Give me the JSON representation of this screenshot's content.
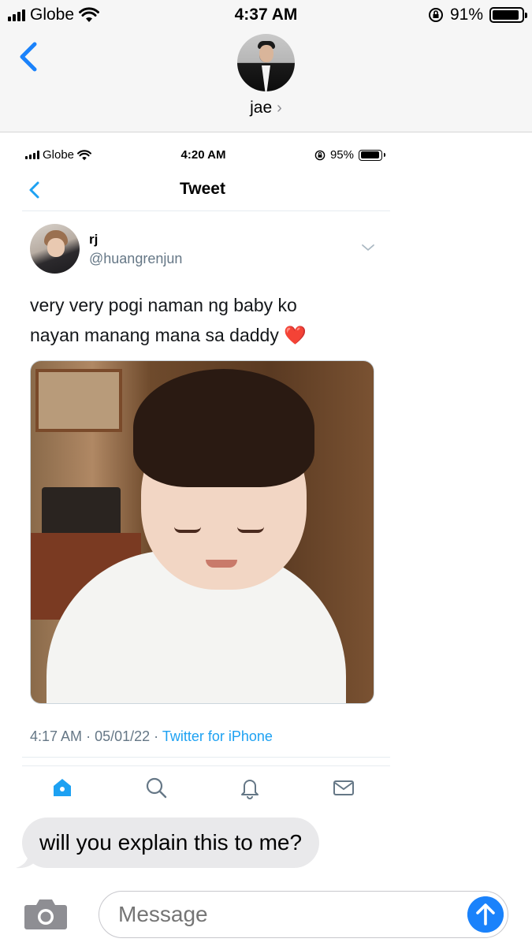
{
  "status_bar": {
    "carrier": "Globe",
    "time": "4:37 AM",
    "battery_pct": "91%",
    "battery_level": 0.91
  },
  "conversation": {
    "contact_name": "jae",
    "contact_chevron": "›"
  },
  "screenshot": {
    "status_bar": {
      "carrier": "Globe",
      "time": "4:20 AM",
      "battery_pct": "95%",
      "battery_level": 0.95
    },
    "nav_title": "Tweet",
    "tweet": {
      "author_name": "rj",
      "author_handle": "@huangrenjun",
      "text_line1": "very very pogi naman ng baby ko",
      "text_line2": "nayan manang mana sa daddy ❤️",
      "time": "4:17 AM",
      "date": "05/01/22",
      "separator": "·",
      "source": "Twitter for iPhone"
    },
    "tabbar": [
      "home-icon",
      "search-icon",
      "notifications-icon",
      "messages-icon"
    ],
    "colors": {
      "accent": "#1da1f2",
      "secondary_text": "#657786"
    }
  },
  "message": {
    "text": "will you explain this to me?"
  },
  "composer": {
    "placeholder": "Message"
  },
  "colors": {
    "imessage_blue": "#1a82fb",
    "back_blue": "#1a82fb",
    "bubble_gray": "#e9e9eb"
  }
}
